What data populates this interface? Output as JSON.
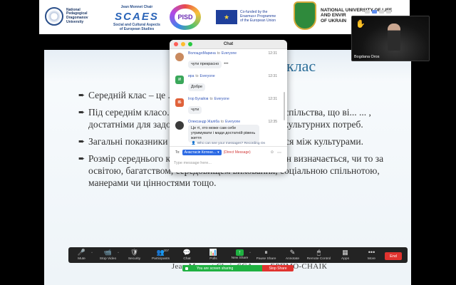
{
  "logos": {
    "npu": [
      "National",
      "Pedagogical",
      "Dragomanov",
      "University"
    ],
    "scaes": {
      "top": "Jean Monnet Chair",
      "mark": "SCAES",
      "lines": [
        "Social and Cultural Aspects",
        "of European Studies"
      ]
    },
    "pisd": "PISD",
    "eu": [
      "Co-funded by the",
      "Erasmus+ Programme",
      "of the European Union"
    ],
    "nulu": [
      "NATIONAL UNIVERSITY OF LIFE",
      "AND ENVIR",
      "OF UKRAIN"
    ]
  },
  "slide": {
    "title": "клас",
    "bullets": [
      "Середній клас – це ... ... альної ієрархії.",
      "Під середнім класо... ... соціальної структури суспільства, що ві... ... , достатніми для задоволення широ... ... альних і культурних потреб.",
      "Загальні показники ... ... ій клас, суттєво різняться між культурами.",
      "Розмір середнього класу залежить від того, як він визначається, чи то за освітою, багатством, середовищем виховання, соціальною спільнотою, манерами чи цінностями тощо."
    ],
    "footer": "Jean Monnet Chair SCA... ... ЕРПМО-СНАІК"
  },
  "chat": {
    "title": "Chat",
    "messages": [
      {
        "sender": "ВолощукМарина",
        "to": "to",
        "recipient": "Everyone",
        "time": "12:31",
        "text": "чути прекрасно",
        "avatar_text": "",
        "avatar_color": "#c98a5f"
      },
      {
        "sender": "ира",
        "to": "to",
        "recipient": "Everyone",
        "time": "12:31",
        "text": "Добре",
        "avatar_text": "И",
        "avatar_color": "#3aa75a"
      },
      {
        "sender": "Ігор Бугайов",
        "to": "to",
        "recipient": "Everyone",
        "time": "12:31",
        "text": "чути",
        "avatar_text": "ІБ",
        "avatar_color": "#e0623a"
      },
      {
        "sender": "Олександр Жаліба",
        "to": "to",
        "recipient": "Everyone",
        "time": "12:35",
        "text": "Це ті, хто може сам себе утримувати і мади достатній рівень життя",
        "avatar_text": "",
        "avatar_color": "#3b3b3b"
      }
    ],
    "privacy": "Who can see your messages? Recording On",
    "to_label": "To:",
    "recipient": "Анастасія Котене...",
    "direct_label": "(Direct Message)",
    "input_placeholder": "Type message here..."
  },
  "video": {
    "name": "Bogdana Oros"
  },
  "toolbar": {
    "items": [
      {
        "label": "Mute",
        "icon": "🎤"
      },
      {
        "label": "Stop Video",
        "icon": "📹"
      },
      {
        "label": "Security",
        "icon": "🛡"
      },
      {
        "label": "Participants",
        "icon": "👥",
        "count": "207"
      },
      {
        "label": "Chat",
        "icon": "💬"
      },
      {
        "label": "Polls",
        "icon": "📊"
      },
      {
        "label": "New Share",
        "icon": "↑"
      },
      {
        "label": "Pause Share",
        "icon": "⏸"
      },
      {
        "label": "Annotate",
        "icon": "✎"
      },
      {
        "label": "Remote Control",
        "icon": "🖱"
      },
      {
        "label": "Apps",
        "icon": "▦"
      },
      {
        "label": "More",
        "icon": "•••"
      }
    ],
    "end": "End"
  },
  "sharing": {
    "status": "You are screen sharing",
    "stop": "Stop Share"
  },
  "colors": {
    "accent": "#2d6be4",
    "share_green": "#1fb141",
    "stop_red": "#e0332f"
  }
}
